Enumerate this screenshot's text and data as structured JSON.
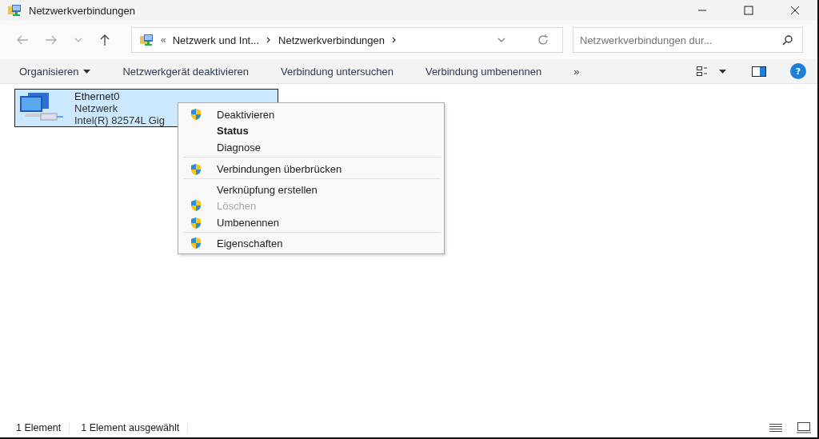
{
  "window": {
    "title": "Netzwerkverbindungen"
  },
  "address_bar": {
    "overflow": "«",
    "segments": [
      "Netzwerk und Int...",
      "Netzwerkverbindungen"
    ]
  },
  "search": {
    "placeholder": "Netzwerkverbindungen dur..."
  },
  "command_bar": {
    "organize": "Organisieren",
    "commands": [
      "Netzwerkgerät deaktivieren",
      "Verbindung untersuchen",
      "Verbindung umbenennen"
    ],
    "more": "»",
    "help": "?"
  },
  "items": [
    {
      "name": "Ethernet0",
      "status": "Netzwerk",
      "device": "Intel(R) 82574L Gig",
      "selected": true
    }
  ],
  "context_menu": [
    {
      "label": "Deaktivieren",
      "shield": true,
      "default": false,
      "disabled": false,
      "separator_after": false
    },
    {
      "label": "Status",
      "shield": false,
      "default": true,
      "disabled": false,
      "separator_after": false
    },
    {
      "label": "Diagnose",
      "shield": false,
      "default": false,
      "disabled": false,
      "separator_after": true
    },
    {
      "label": "Verbindungen überbrücken",
      "shield": true,
      "default": false,
      "disabled": false,
      "separator_after": true
    },
    {
      "label": "Verknüpfung erstellen",
      "shield": false,
      "default": false,
      "disabled": false,
      "separator_after": false
    },
    {
      "label": "Löschen",
      "shield": true,
      "default": false,
      "disabled": true,
      "separator_after": false
    },
    {
      "label": "Umbenennen",
      "shield": true,
      "default": false,
      "disabled": false,
      "separator_after": true
    },
    {
      "label": "Eigenschaften",
      "shield": true,
      "default": false,
      "disabled": false,
      "separator_after": false
    }
  ],
  "status_bar": {
    "count": "1 Element",
    "selection": "1 Element ausgewählt"
  }
}
